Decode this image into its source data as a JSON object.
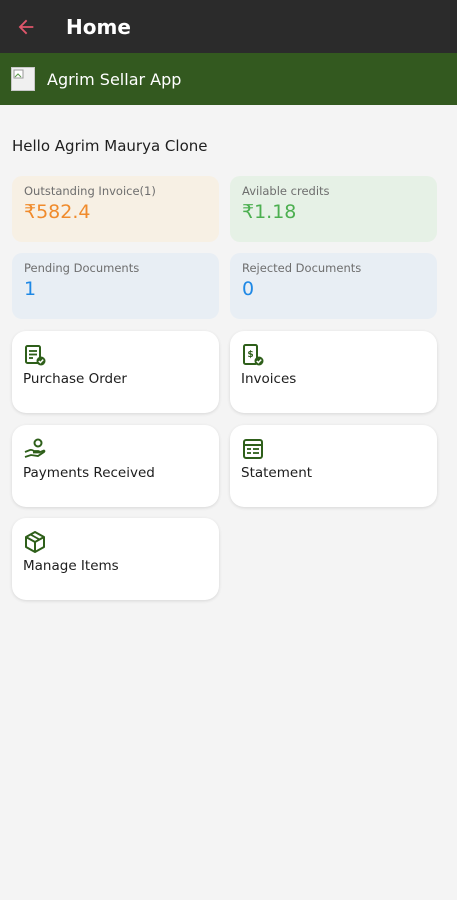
{
  "appbar": {
    "title": "Home",
    "back_icon": "arrow-left-icon"
  },
  "brand": {
    "title": "Agrim Sellar App",
    "logo_icon": "broken-image-icon"
  },
  "greeting": "Hello Agrim Maurya Clone",
  "stats": {
    "outstanding": {
      "label": "Outstanding Invoice(1)",
      "value": "₹582.4",
      "color": "#f08b2c",
      "bg": "#f7f0e4"
    },
    "credits": {
      "label": "Avilable credits",
      "value": "₹1.18",
      "color": "#4caf50",
      "bg": "#e6f1e6"
    },
    "pending": {
      "label": "Pending Documents",
      "value": "1",
      "color": "#1e88e5",
      "bg": "#e8eef4"
    },
    "rejected": {
      "label": "Rejected Documents",
      "value": "0",
      "color": "#1e88e5",
      "bg": "#e8eef4"
    }
  },
  "tiles": {
    "purchase_order": {
      "label": "Purchase Order",
      "icon": "purchase-order-icon"
    },
    "invoices": {
      "label": "Invoices",
      "icon": "invoice-icon"
    },
    "payments_received": {
      "label": "Payments Received",
      "icon": "payments-icon"
    },
    "statement": {
      "label": "Statement",
      "icon": "statement-icon"
    },
    "manage_items": {
      "label": "Manage Items",
      "icon": "package-icon"
    }
  },
  "colors": {
    "appbar": "#2b2b2b",
    "brandbar": "#33591f",
    "icon_green": "#2e5f1a",
    "back_arrow": "#e0566b"
  }
}
